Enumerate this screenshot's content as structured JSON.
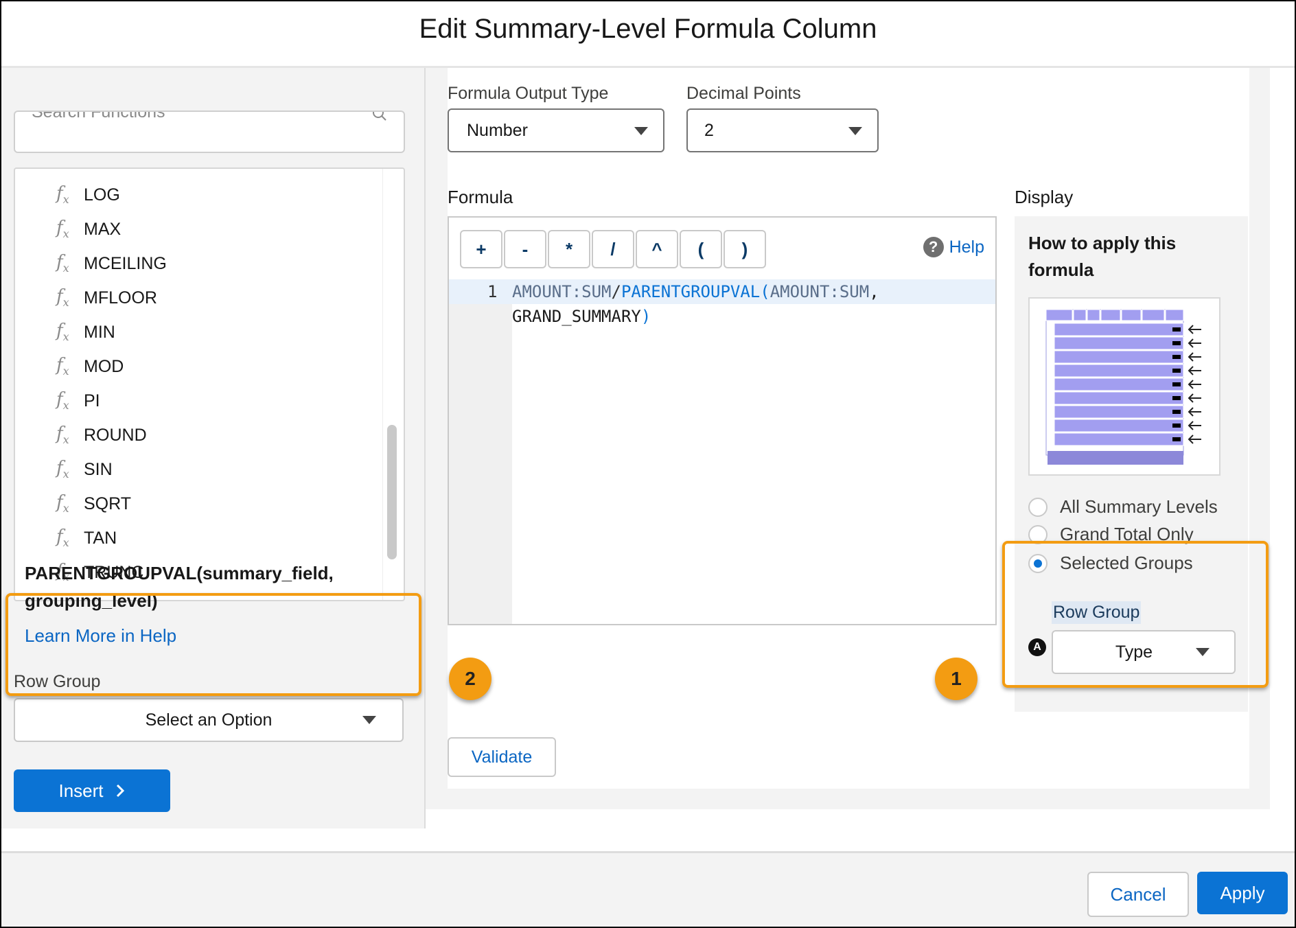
{
  "dialog": {
    "title": "Edit Summary-Level Formula Column"
  },
  "functions_panel": {
    "search_placeholder": "Search Functions",
    "items": [
      "LOG",
      "MAX",
      "MCEILING",
      "MFLOOR",
      "MIN",
      "MOD",
      "PI",
      "ROUND",
      "SIN",
      "SQRT",
      "TAN",
      "TRUNC"
    ],
    "fx_symbol": "f",
    "fx_sub": "x",
    "signature_line1": "PARENTGROUPVAL(summary_field,",
    "signature_line2": "grouping_level)",
    "learn_more": "Learn More in Help",
    "row_group_label": "Row Group",
    "row_group_value": "Select an Option",
    "insert_label": "Insert",
    "insert_icon": "chevron-right-icon"
  },
  "output": {
    "type_label": "Formula Output Type",
    "type_value": "Number",
    "decimal_label": "Decimal Points",
    "decimal_value": "2"
  },
  "formula": {
    "label": "Formula",
    "operators": [
      "+",
      "-",
      "*",
      "/",
      "^",
      "(",
      ")"
    ],
    "help_label": "Help",
    "line_number": "1",
    "code": {
      "a1": "AMOUNT:SUM",
      "op1": "/",
      "fn": "PARENTGROUPVAL",
      "p1": "(",
      "a2": "AMOUNT:SUM",
      "comma": ",",
      "arg2": "GRAND_SUMMARY",
      "p2": ")"
    },
    "validate_label": "Validate"
  },
  "display": {
    "label": "Display",
    "howto_line1": "How to apply this",
    "howto_line2": "formula",
    "options": [
      "All Summary Levels",
      "Grand Total Only",
      "Selected Groups"
    ],
    "selected_option": "Selected Groups",
    "row_group_label": "Row Group",
    "row_group_value": "Type",
    "a_icon": "A"
  },
  "callouts": {
    "right": "1",
    "left": "2"
  },
  "footer": {
    "cancel_label": "Cancel",
    "apply_label": "Apply"
  },
  "colors": {
    "brand_blue": "#0b73d4",
    "callout_orange": "#f39c12",
    "diagram_purple": "#a29ef0"
  }
}
